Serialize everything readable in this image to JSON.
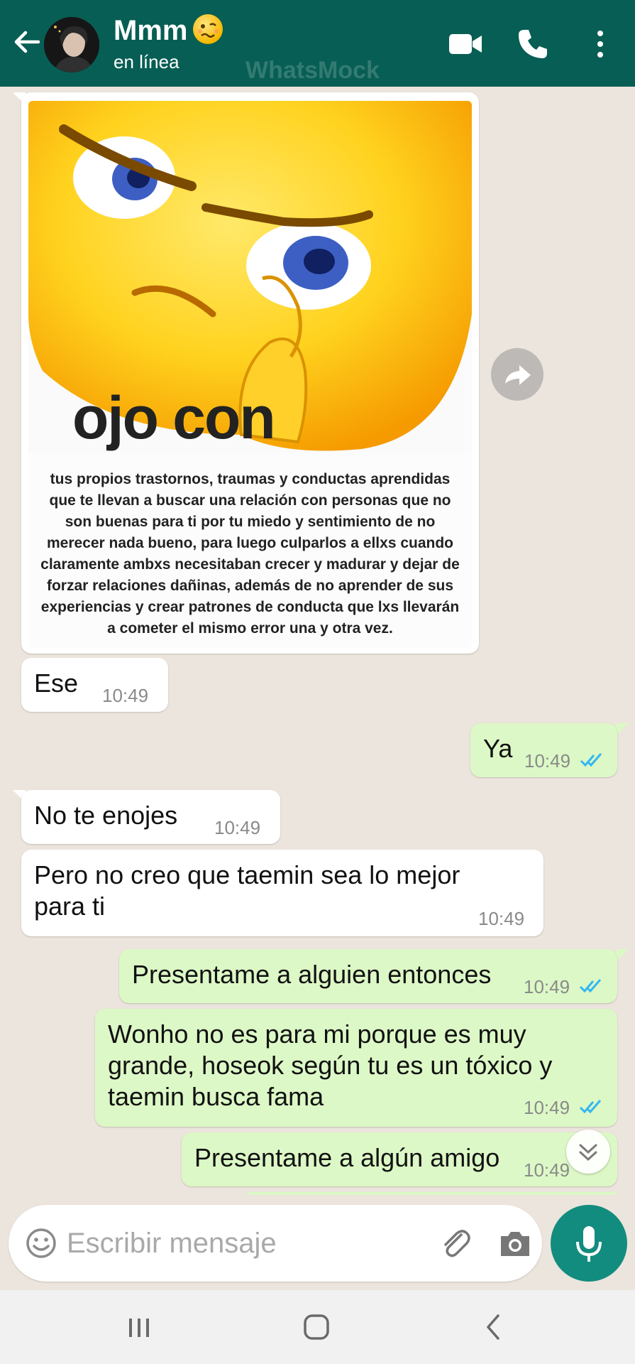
{
  "header": {
    "contact_name": "Mmm",
    "status": "en línea",
    "watermark": "WhatsMock"
  },
  "image_message": {
    "big_text": "ojo con",
    "small_text": "tus propios trastornos, traumas y conductas aprendidas que te llevan a buscar una relación con personas que no son buenas para ti por tu miedo y sentimiento de no merecer nada bueno, para luego culparlos a ellxs cuando claramente ambxs necesitaban crecer y madurar y dejar de forzar relaciones dañinas, además de no aprender de sus experiencias y crear patrones de conducta que lxs llevarán a cometer el mismo error una y otra vez."
  },
  "messages": [
    {
      "dir": "in",
      "text": "Ese",
      "time": "10:49"
    },
    {
      "dir": "out",
      "text": "Ya",
      "time": "10:49"
    },
    {
      "dir": "in",
      "text": "No te enojes",
      "time": "10:49"
    },
    {
      "dir": "in",
      "text": "Pero no creo que taemin sea lo mejor para ti",
      "time": "10:49"
    },
    {
      "dir": "out",
      "text": "Presentame a alguien entonces",
      "time": "10:49"
    },
    {
      "dir": "out",
      "text": "Wonho no es para mi porque es muy grande, hoseok según tu es un tóxico y taemin busca fama",
      "time": "10:49"
    },
    {
      "dir": "out",
      "text": "Presentame a algún amigo",
      "time": "10:49"
    }
  ],
  "input": {
    "placeholder": "Escribir mensaje"
  },
  "colors": {
    "header": "#075e54",
    "chat_bg": "#ece5dd",
    "outgoing": "#dcf8c6",
    "incoming": "#ffffff",
    "read_ticks": "#34b7f1",
    "mic": "#128c7e"
  },
  "icons": {
    "back": "back-arrow-icon",
    "video": "video-call-icon",
    "call": "phone-icon",
    "more": "more-vertical-icon",
    "emoji": "emoji-icon",
    "attach": "paperclip-icon",
    "camera": "camera-icon",
    "mic": "mic-icon",
    "forward": "forward-icon",
    "scroll": "double-chevron-down-icon"
  }
}
